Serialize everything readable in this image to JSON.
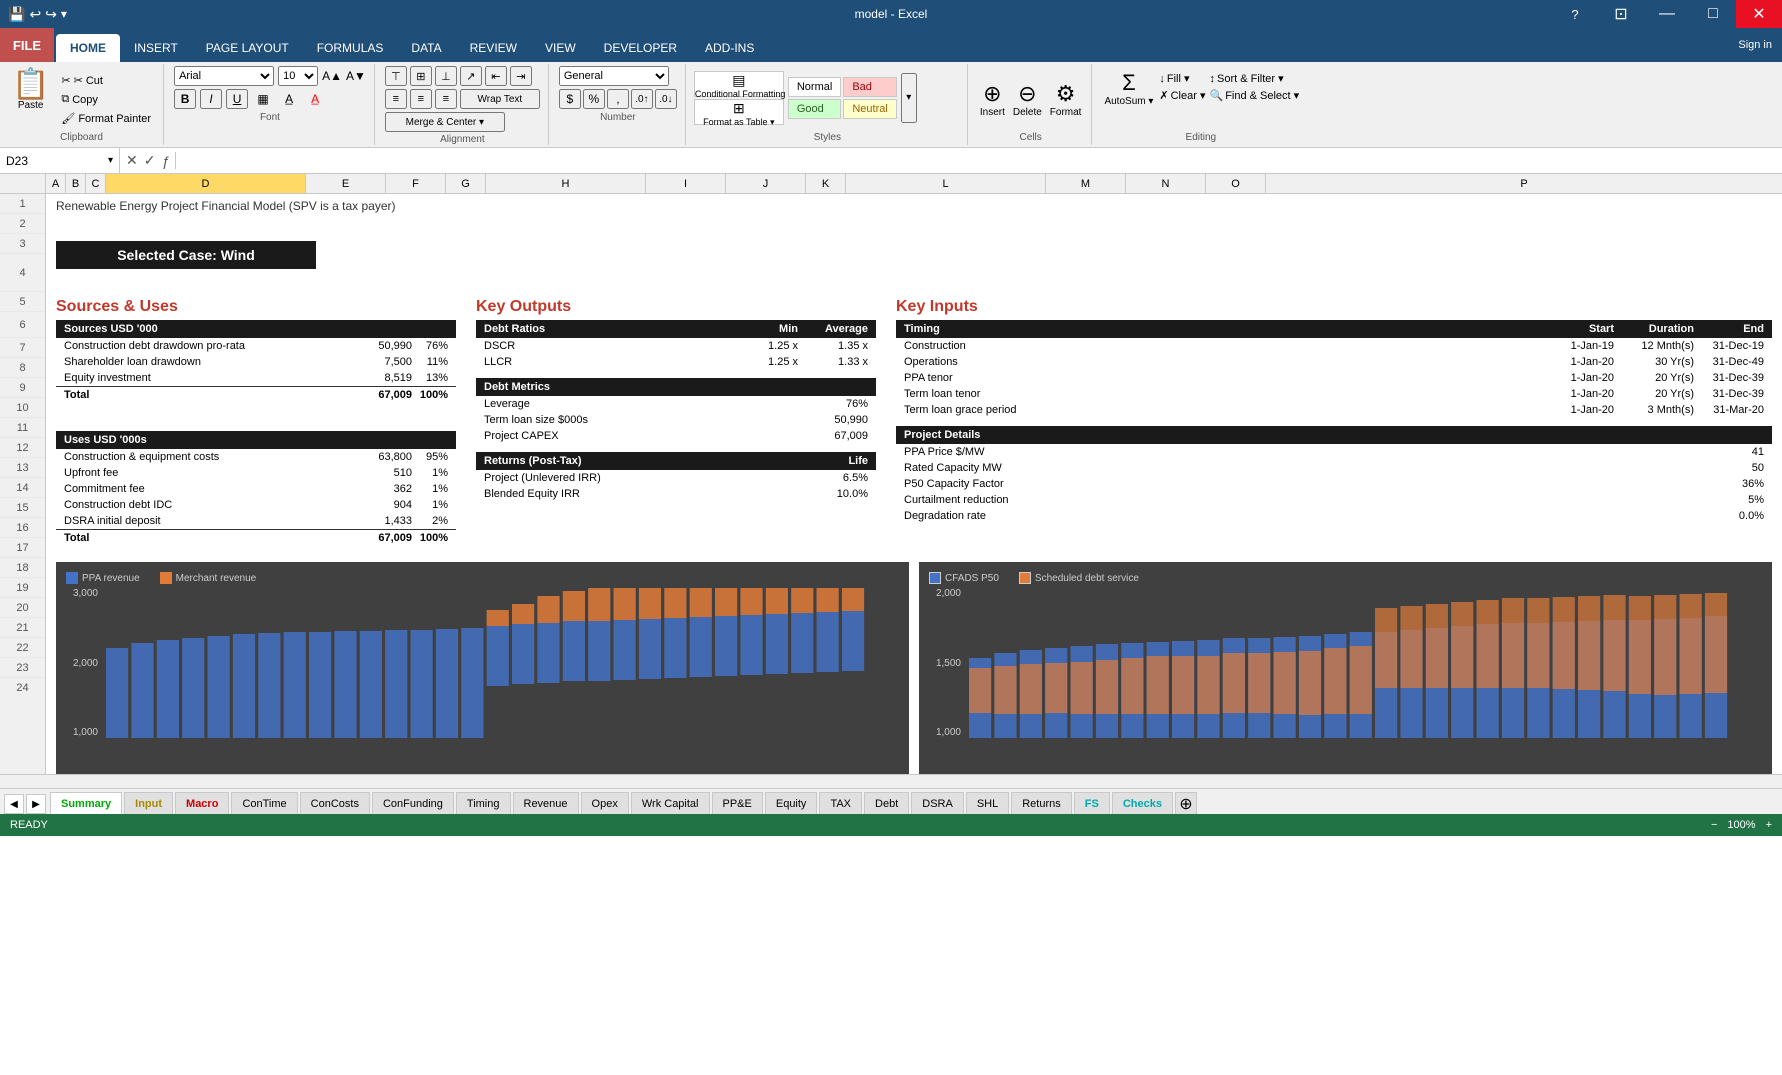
{
  "window": {
    "title": "model - Excel",
    "controls": [
      "?",
      "−",
      "□",
      "✕"
    ]
  },
  "ribbon": {
    "tabs": [
      "FILE",
      "HOME",
      "INSERT",
      "PAGE LAYOUT",
      "FORMULAS",
      "DATA",
      "REVIEW",
      "VIEW",
      "DEVELOPER",
      "ADD-INS"
    ],
    "active_tab": "HOME",
    "clipboard": {
      "paste_label": "Paste",
      "cut_label": "✂ Cut",
      "copy_label": "Copy",
      "format_painter_label": "Format Painter",
      "group_label": "Clipboard"
    },
    "font": {
      "family": "Arial",
      "size": "10",
      "bold": "B",
      "italic": "I",
      "underline": "U",
      "group_label": "Font"
    },
    "alignment": {
      "wrap_text": "Wrap Text",
      "merge_center": "Merge & Center ▾",
      "group_label": "Alignment"
    },
    "number": {
      "format": "General",
      "group_label": "Number"
    },
    "styles": {
      "normal": "Normal",
      "bad": "Bad",
      "good": "Good",
      "neutral": "Neutral",
      "conditional_formatting": "Conditional Formatting",
      "format_as_table": "Format as Table",
      "group_label": "Styles"
    },
    "cells": {
      "insert": "Insert",
      "delete": "Delete",
      "format": "Format",
      "group_label": "Cells"
    },
    "editing": {
      "autosum": "AutoSum ▾",
      "fill": "Fill ▾",
      "clear": "Clear ▾",
      "sort_filter": "Sort & Filter ▾",
      "find_select": "Find & Select ▾",
      "group_label": "Editing"
    },
    "sign_in": "Sign in"
  },
  "formula_bar": {
    "cell_ref": "D23",
    "formula": ""
  },
  "columns": [
    "D",
    "E",
    "F",
    "G",
    "H",
    "I",
    "J",
    "K",
    "L",
    "M",
    "N",
    "O",
    "P"
  ],
  "sheet": {
    "title": "Renewable Energy Project Financial Model (SPV is a tax payer)",
    "selected_case": "Selected Case: Wind",
    "sources_uses": {
      "header": "Sources & Uses",
      "sources_table": {
        "header": "Sources USD '000",
        "rows": [
          {
            "label": "Construction debt drawdown pro-rata",
            "value": "50,990",
            "pct": "76%"
          },
          {
            "label": "Shareholder loan drawdown",
            "value": "7,500",
            "pct": "11%"
          },
          {
            "label": "Equity investment",
            "value": "8,519",
            "pct": "13%"
          },
          {
            "label": "Total",
            "value": "67,009",
            "pct": "100%",
            "is_total": true
          }
        ]
      },
      "uses_table": {
        "header": "Uses USD '000s",
        "rows": [
          {
            "label": "Construction & equipment costs",
            "value": "63,800",
            "pct": "95%"
          },
          {
            "label": "Upfront fee",
            "value": "510",
            "pct": "1%"
          },
          {
            "label": "Commitment fee",
            "value": "362",
            "pct": "1%"
          },
          {
            "label": "Construction debt IDC",
            "value": "904",
            "pct": "1%"
          },
          {
            "label": "DSRA initial deposit",
            "value": "1,433",
            "pct": "2%"
          },
          {
            "label": "Total",
            "value": "67,009",
            "pct": "100%",
            "is_total": true
          }
        ]
      }
    },
    "key_outputs": {
      "header": "Key Outputs",
      "debt_ratios": {
        "header": "Debt Ratios",
        "col_min": "Min",
        "col_avg": "Average",
        "rows": [
          {
            "label": "DSCR",
            "min": "1.25 x",
            "avg": "1.35 x"
          },
          {
            "label": "LLCR",
            "min": "1.25 x",
            "avg": "1.33 x"
          }
        ]
      },
      "debt_metrics": {
        "header": "Debt Metrics",
        "rows": [
          {
            "label": "Leverage",
            "value": "76%"
          },
          {
            "label": "Term loan size $000s",
            "value": "50,990"
          },
          {
            "label": "Project CAPEX",
            "value": "67,009"
          }
        ]
      },
      "returns": {
        "header": "Returns (Post-Tax)",
        "col_life": "Life",
        "rows": [
          {
            "label": "Project (Unlevered IRR)",
            "value": "6.5%"
          },
          {
            "label": "Blended Equity IRR",
            "value": "10.0%"
          }
        ]
      }
    },
    "key_inputs": {
      "header": "Key Inputs",
      "timing": {
        "header": "Timing",
        "col_start": "Start",
        "col_duration": "Duration",
        "col_end": "End",
        "rows": [
          {
            "label": "Construction",
            "start": "1-Jan-19",
            "duration": "12 Mnth(s)",
            "end": "31-Dec-19"
          },
          {
            "label": "Operations",
            "start": "1-Jan-20",
            "duration": "30 Yr(s)",
            "end": "31-Dec-49"
          },
          {
            "label": "PPA tenor",
            "start": "1-Jan-20",
            "duration": "20 Yr(s)",
            "end": "31-Dec-39"
          },
          {
            "label": "Term loan tenor",
            "start": "1-Jan-20",
            "duration": "20 Yr(s)",
            "end": "31-Dec-39"
          },
          {
            "label": "Term loan grace period",
            "start": "1-Jan-20",
            "duration": "3 Mnth(s)",
            "end": "31-Mar-20"
          }
        ]
      },
      "project_details": {
        "header": "Project Details",
        "rows": [
          {
            "label": "PPA Price $/MW",
            "value": "41"
          },
          {
            "label": "Rated Capacity MW",
            "value": "50"
          },
          {
            "label": "P50 Capacity Factor",
            "value": "36%"
          },
          {
            "label": "Curtailment reduction",
            "value": "5%"
          },
          {
            "label": "Degradation rate",
            "value": "0.0%"
          }
        ]
      }
    },
    "charts": {
      "left": {
        "y_labels": [
          "3,000",
          "2,000",
          "1,000"
        ],
        "legend": [
          {
            "label": "PPA revenue",
            "color": "#4472c4"
          },
          {
            "label": "Merchant revenue",
            "color": "#e07b39"
          }
        ]
      },
      "right": {
        "y_labels": [
          "2,000",
          "1,500",
          "1,000"
        ],
        "legend": [
          {
            "label": "CFADS P50",
            "color": "#4472c4"
          },
          {
            "label": "Scheduled debt service",
            "color": "#e07b39"
          }
        ]
      }
    }
  },
  "sheet_tabs": [
    {
      "label": "Summary",
      "style": "active green"
    },
    {
      "label": "Input",
      "style": "yellow"
    },
    {
      "label": "Macro",
      "style": "red"
    },
    {
      "label": "ConTime",
      "style": "normal"
    },
    {
      "label": "ConCosts",
      "style": "normal"
    },
    {
      "label": "ConFunding",
      "style": "normal"
    },
    {
      "label": "Timing",
      "style": "normal"
    },
    {
      "label": "Revenue",
      "style": "normal"
    },
    {
      "label": "Opex",
      "style": "normal"
    },
    {
      "label": "Wrk Capital",
      "style": "normal"
    },
    {
      "label": "PP&E",
      "style": "normal"
    },
    {
      "label": "Equity",
      "style": "normal"
    },
    {
      "label": "TAX",
      "style": "normal"
    },
    {
      "label": "Debt",
      "style": "normal"
    },
    {
      "label": "DSRA",
      "style": "normal"
    },
    {
      "label": "SHL",
      "style": "normal"
    },
    {
      "label": "Returns",
      "style": "normal"
    },
    {
      "label": "FS",
      "style": "cyan"
    },
    {
      "label": "Checks",
      "style": "cyan"
    }
  ],
  "status_bar": {
    "ready": "READY",
    "zoom": "100%"
  }
}
